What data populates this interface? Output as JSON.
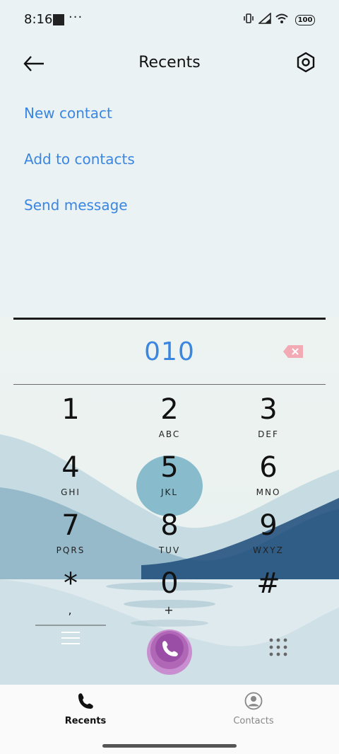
{
  "status_bar": {
    "time": "8:16",
    "battery": "100"
  },
  "header": {
    "title": "Recents"
  },
  "actions": [
    "New contact",
    "Add to contacts",
    "Send message"
  ],
  "dialer": {
    "number": "010",
    "keys": [
      {
        "digit": "1",
        "letters": ""
      },
      {
        "digit": "2",
        "letters": "ABC"
      },
      {
        "digit": "3",
        "letters": "DEF"
      },
      {
        "digit": "4",
        "letters": "GHI"
      },
      {
        "digit": "5",
        "letters": "JKL"
      },
      {
        "digit": "6",
        "letters": "MNO"
      },
      {
        "digit": "7",
        "letters": "PQRS"
      },
      {
        "digit": "8",
        "letters": "TUV"
      },
      {
        "digit": "9",
        "letters": "WXYZ"
      },
      {
        "digit": "*",
        "letters": ","
      },
      {
        "digit": "0",
        "letters": "+"
      },
      {
        "digit": "#",
        "letters": ""
      }
    ]
  },
  "bottom_nav": {
    "recents": "Recents",
    "contacts": "Contacts"
  },
  "colors": {
    "accent": "#3a86e0",
    "call_button": "#b067b6"
  }
}
